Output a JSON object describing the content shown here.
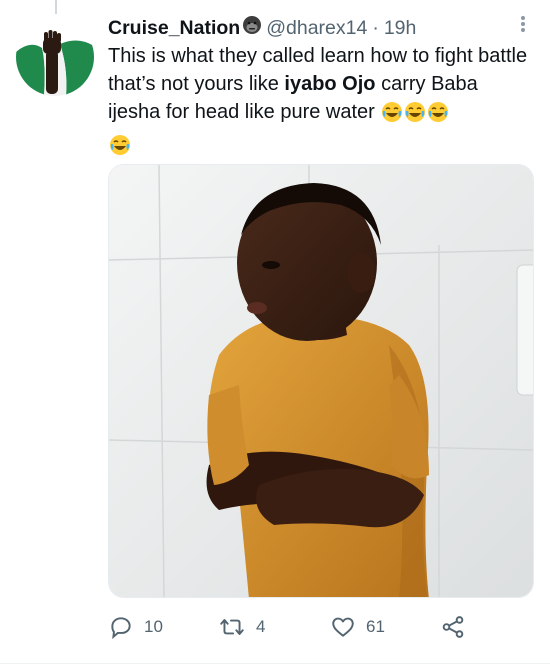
{
  "tweet": {
    "display_name": "Cruise_Nation",
    "handle": "@dharex14",
    "separator": "·",
    "time": "19h",
    "name_emoji": "gorilla-emoji",
    "text": {
      "part1": "This is what they called learn how to fight battle that’s not yours like ",
      "bold": "iyabo Ojo",
      "part2": " carry Baba ijesha for head like pure water",
      "emojis": [
        "face-with-tears-of-joy-emoji",
        "face-with-tears-of-joy-emoji",
        "face-with-tears-of-joy-emoji",
        "face-with-tears-of-joy-emoji"
      ]
    },
    "avatar": "raised-fist-on-nigeria-flag",
    "media": "boy-in-orange-shirt-arms-crossed-photo"
  },
  "actions": {
    "reply": {
      "icon": "reply-icon",
      "count": "10"
    },
    "retweet": {
      "icon": "retweet-icon",
      "count": "4"
    },
    "like": {
      "icon": "heart-icon",
      "count": "61"
    },
    "share": {
      "icon": "share-icon",
      "count": ""
    }
  },
  "colors": {
    "text": "#0f1419",
    "secondary": "#536471",
    "nigeria_green": "#1f8a4c"
  }
}
